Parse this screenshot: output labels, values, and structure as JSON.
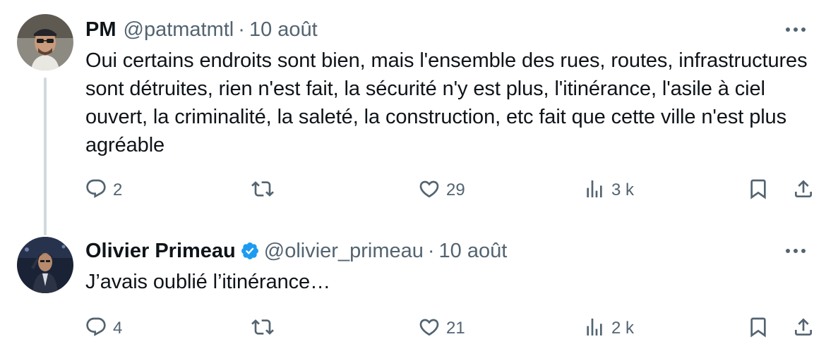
{
  "tweets": [
    {
      "display_name": "PM",
      "handle": "@patmatmtl",
      "separator": "·",
      "date": "10 août",
      "verified": false,
      "text": "Oui certains endroits sont bien, mais l'ensemble des rues, routes, infrastructures sont détruites, rien n'est fait, la sécurité n'y est plus, l'itinérance, l'asile à ciel ouvert, la criminalité, la saleté, la construction, etc fait que cette ville n'est plus agréable",
      "replies": "2",
      "likes": "29",
      "views": "3 k"
    },
    {
      "display_name": "Olivier Primeau",
      "handle": "@olivier_primeau",
      "separator": "·",
      "date": "10 août",
      "verified": true,
      "text": "J’avais oublié l’itinérance…",
      "replies": "4",
      "likes": "21",
      "views": "2 k"
    }
  ],
  "colors": {
    "text_primary": "#0f1419",
    "text_secondary": "#536471",
    "verified_blue": "#1d9bf0",
    "thread_line": "#cfd9de"
  },
  "icons": [
    "more-icon",
    "reply-icon",
    "retweet-icon",
    "like-icon",
    "views-icon",
    "bookmark-icon",
    "share-icon",
    "verified-badge-icon"
  ]
}
